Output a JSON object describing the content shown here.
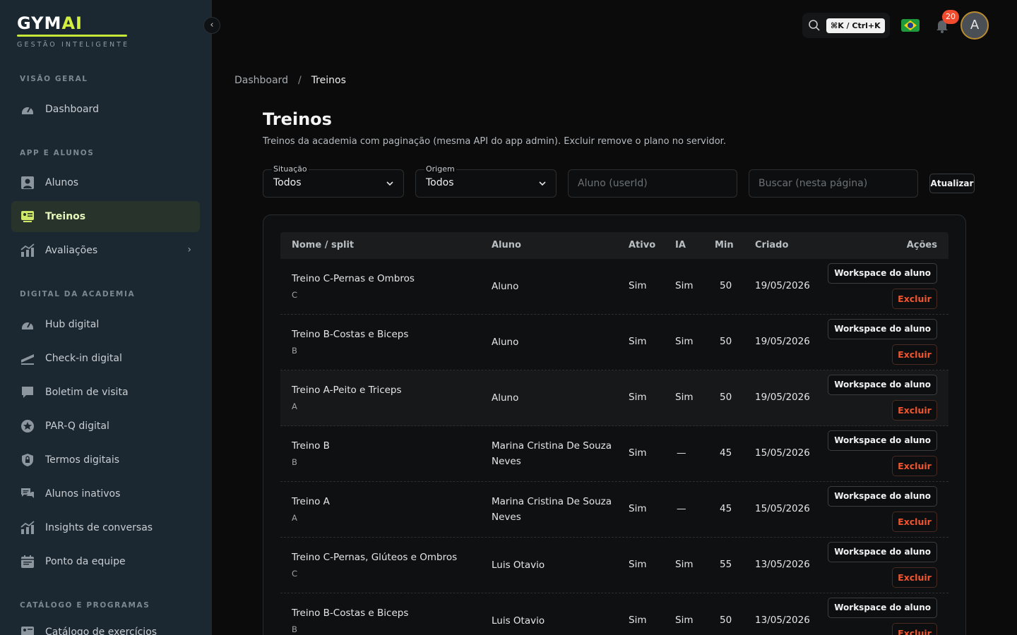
{
  "brand": {
    "name_part1": "GYM",
    "name_part2": "AI",
    "tagline": "GESTÃO INTELIGENTE"
  },
  "sidebar": {
    "sections": [
      {
        "title": "VISÃO GERAL"
      },
      {
        "title": "APP E ALUNOS"
      },
      {
        "title": "DIGITAL DA ACADEMIA"
      },
      {
        "title": "CATÁLOGO E PROGRAMAS"
      }
    ],
    "items": [
      {
        "label": "Dashboard",
        "icon": "gauge-icon"
      },
      {
        "label": "Alunos",
        "icon": "person-icon"
      },
      {
        "label": "Treinos",
        "icon": "workout-icon",
        "active": true
      },
      {
        "label": "Avaliações",
        "icon": "chart-icon",
        "has_submenu": true
      },
      {
        "label": "Hub digital",
        "icon": "gauge-icon"
      },
      {
        "label": "Check-in digital",
        "icon": "checkin-icon"
      },
      {
        "label": "Boletim de visita",
        "icon": "comment-icon"
      },
      {
        "label": "PAR-Q digital",
        "icon": "star-icon"
      },
      {
        "label": "Termos digitais",
        "icon": "lock-icon"
      },
      {
        "label": "Alunos inativos",
        "icon": "chat-icon"
      },
      {
        "label": "Insights de conversas",
        "icon": "chart-icon"
      },
      {
        "label": "Ponto da equipe",
        "icon": "calendar-icon"
      },
      {
        "label": "Catálogo de exercícios",
        "icon": "workout-icon"
      }
    ]
  },
  "topbar": {
    "shortcut": "⌘K / Ctrl+K",
    "notification_count": "20",
    "avatar_initial": "A"
  },
  "breadcrumb": {
    "home": "Dashboard",
    "separator": "/",
    "current": "Treinos"
  },
  "page": {
    "title": "Treinos",
    "description": "Treinos da academia com paginação (mesma API do app admin). Excluir remove o plano no servidor."
  },
  "filters": {
    "situacao": {
      "label": "Situação",
      "value": "Todos"
    },
    "origem": {
      "label": "Origem",
      "value": "Todos"
    },
    "aluno_placeholder": "Aluno (userId)",
    "search_placeholder": "Buscar (nesta página)",
    "refresh_label": "Atualizar"
  },
  "table": {
    "headers": {
      "name": "Nome / split",
      "aluno": "Aluno",
      "ativo": "Ativo",
      "ia": "IA",
      "min": "Min",
      "criado": "Criado",
      "acoes": "Ações"
    },
    "action_workspace": "Workspace do aluno",
    "action_delete": "Excluir",
    "rows": [
      {
        "name": "Treino C-Pernas e Ombros",
        "split": "C",
        "aluno": "Aluno",
        "ativo": "Sim",
        "ia": "Sim",
        "min": "50",
        "criado": "19/05/2026"
      },
      {
        "name": "Treino B-Costas e Biceps",
        "split": "B",
        "aluno": "Aluno",
        "ativo": "Sim",
        "ia": "Sim",
        "min": "50",
        "criado": "19/05/2026"
      },
      {
        "name": "Treino A-Peito e Triceps",
        "split": "A",
        "aluno": "Aluno",
        "ativo": "Sim",
        "ia": "Sim",
        "min": "50",
        "criado": "19/05/2026"
      },
      {
        "name": "Treino B",
        "split": "B",
        "aluno": "Marina Cristina De Souza Neves",
        "ativo": "Sim",
        "ia": "—",
        "min": "45",
        "criado": "15/05/2026"
      },
      {
        "name": "Treino A",
        "split": "A",
        "aluno": "Marina Cristina De Souza Neves",
        "ativo": "Sim",
        "ia": "—",
        "min": "45",
        "criado": "15/05/2026"
      },
      {
        "name": "Treino C-Pernas, Glúteos e Ombros",
        "split": "C",
        "aluno": "Luis Otavio",
        "ativo": "Sim",
        "ia": "Sim",
        "min": "55",
        "criado": "13/05/2026"
      },
      {
        "name": "Treino B-Costas e Biceps",
        "split": "B",
        "aluno": "Luis Otavio",
        "ativo": "Sim",
        "ia": "Sim",
        "min": "50",
        "criado": "13/05/2026"
      }
    ]
  }
}
